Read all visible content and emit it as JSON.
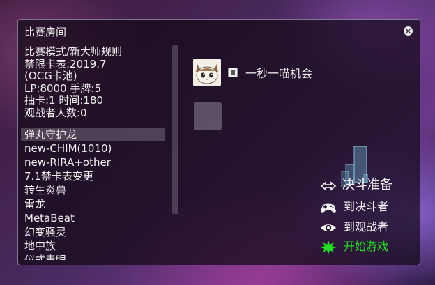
{
  "window": {
    "title": "比赛房间",
    "close_icon": "close-icon"
  },
  "room_info": [
    "比赛模式/新大师规则",
    "禁限卡表:2019.7",
    "(OCG卡池)",
    "LP:8000 手牌:5",
    "抽卡:1 时间:180",
    "观战者人数:0"
  ],
  "deck_list": {
    "selected_index": 0,
    "items": [
      "弹丸守护龙",
      "new-CHIM(1010)",
      "new-RIRA+other",
      "7.1禁卡表变更",
      "转生炎兽",
      "雷龙",
      "MetaBeat",
      "幻变骚灵",
      "地中族",
      "仪式青眼"
    ]
  },
  "players": [
    {
      "name": "一秒一喵机会",
      "avatar": "cat-avatar",
      "ready": true
    }
  ],
  "actions": {
    "duel_ready": {
      "label": "决斗准备",
      "icon": "arrows-icon"
    },
    "to_duelist": {
      "label": "到决斗者",
      "icon": "gamepad-icon"
    },
    "to_observer": {
      "label": "到观战者",
      "icon": "eye-icon"
    },
    "start_game": {
      "label": "开始游戏",
      "icon": "star-burst-icon",
      "color": "#22e022"
    }
  }
}
